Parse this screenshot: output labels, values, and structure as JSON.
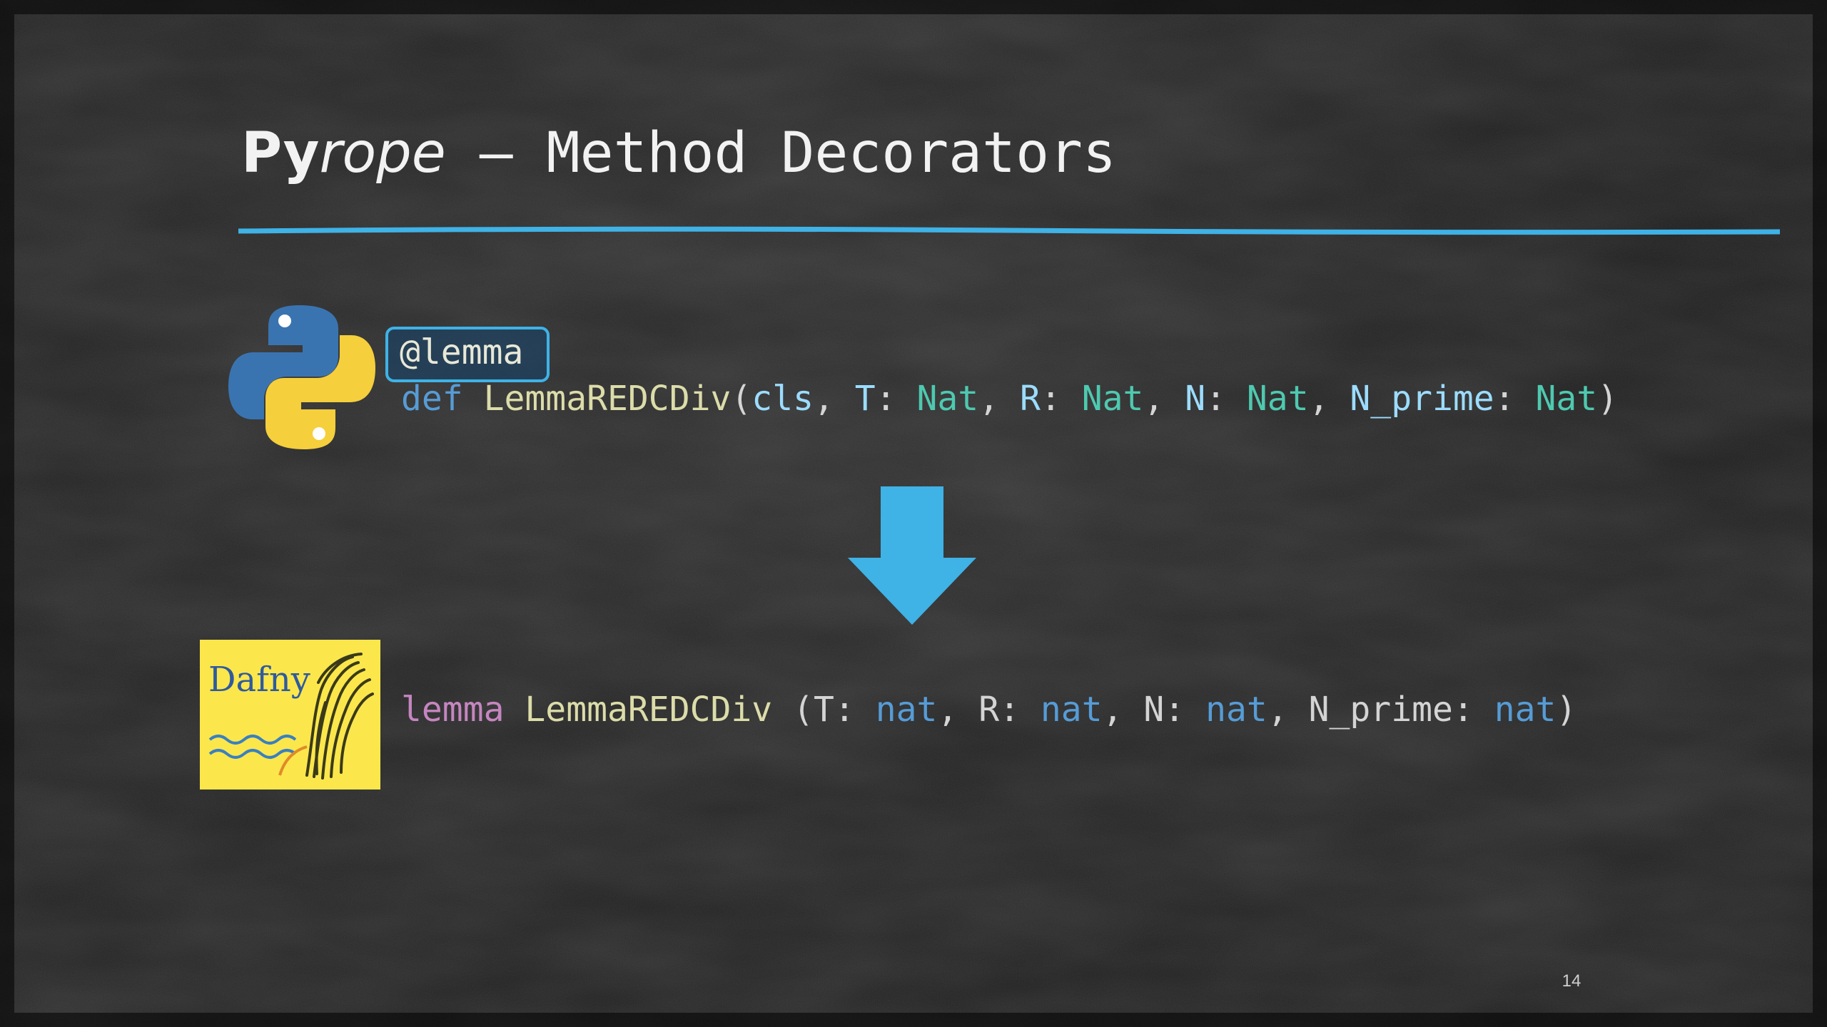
{
  "slide": {
    "title_py": "Py",
    "title_rope": "rope",
    "title_rest": " – Method Decorators",
    "page_number": "14"
  },
  "python_code": {
    "decorator": "@lemma",
    "def_keyword": "def",
    "function_name": "LemmaREDCDiv",
    "open_paren": "(",
    "param_cls": "cls",
    "comma": ", ",
    "colon": ": ",
    "params": [
      {
        "name": "T",
        "type": "Nat"
      },
      {
        "name": "R",
        "type": "Nat"
      },
      {
        "name": "N",
        "type": "Nat"
      },
      {
        "name": "N_prime",
        "type": "Nat"
      }
    ],
    "close_paren": ")"
  },
  "dafny_code": {
    "keyword": "lemma",
    "function_name": "LemmaREDCDiv",
    "open_paren": " (",
    "params": [
      {
        "name": "T",
        "type": "nat"
      },
      {
        "name": "R",
        "type": "nat"
      },
      {
        "name": "N",
        "type": "nat"
      },
      {
        "name": "N_prime",
        "type": "nat"
      }
    ],
    "close_paren": ")"
  },
  "logos": {
    "python": "python-logo",
    "dafny_text": "Dafny"
  },
  "colors": {
    "accent": "#3fb2e6",
    "keyword": "#569cd6",
    "function": "#dcdcaa",
    "param": "#9cdcfe",
    "type": "#4ec9b0",
    "dafny_keyword": "#c586c0",
    "dafny_bg": "#fbe74b"
  }
}
